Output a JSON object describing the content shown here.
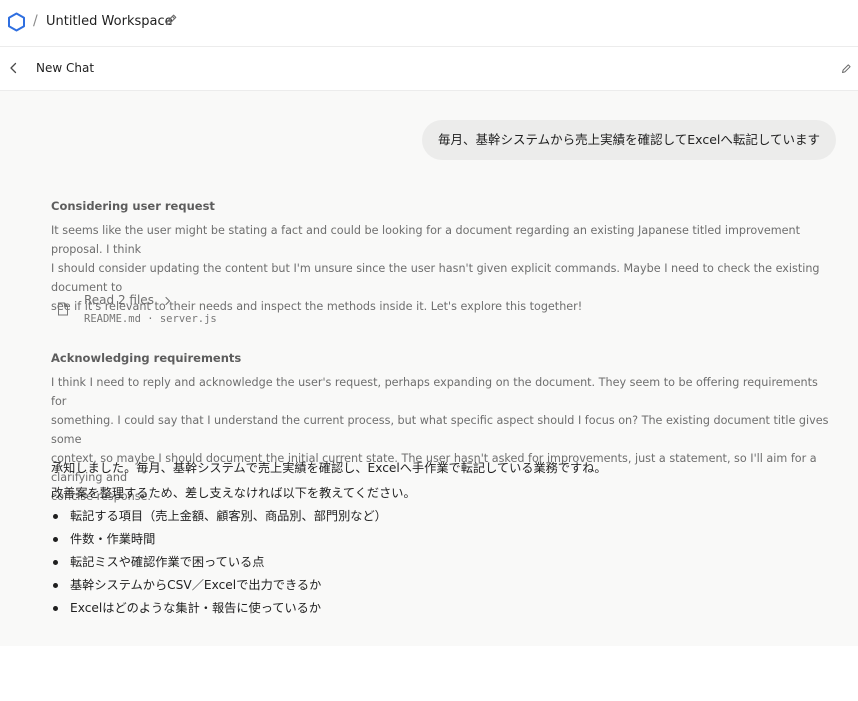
{
  "header": {
    "separator": "/",
    "workspace_title": "Untitled Workspace"
  },
  "chat": {
    "title": "New Chat"
  },
  "messages": {
    "user": "毎月、基幹システムから売上実績を確認してExcelへ転記しています",
    "thinking": [
      {
        "title": "Considering user request",
        "lines": [
          "It seems like the user might be stating a fact and could be looking for a document regarding an existing Japanese titled improvement proposal. I think",
          "I should consider updating the content but I'm unsure since the user hasn't given explicit commands. Maybe I need to check the existing document to",
          "see if it's relevant to their needs and inspect the methods inside it. Let's explore this together!"
        ]
      },
      {
        "title": "Acknowledging requirements",
        "lines": [
          "I think I need to reply and acknowledge the user's request, perhaps expanding on the document. They seem to be offering requirements for",
          "something. I could say that I understand the current process, but what specific aspect should I focus on? The existing document title gives some",
          "context, so maybe I should document the initial current state. The user hasn't asked for improvements, just a statement, so I'll aim for a clarifying and",
          "concise response."
        ]
      }
    ],
    "tool": {
      "label": "Read 2 files",
      "files": "README.md · server.js"
    },
    "assistant": {
      "line1": "承知しました。毎月、基幹システムで売上実績を確認し、Excelへ手作業で転記している業務ですね。",
      "line2": "改善案を整理するため、差し支えなければ以下を教えてください。",
      "bullets": [
        "転記する項目（売上金額、顧客別、商品別、部門別など）",
        "件数・作業時間",
        "転記ミスや確認作業で困っている点",
        "基幹システムからCSV／Excelで出力できるか",
        "Excelはどのような集計・報告に使っているか"
      ]
    }
  },
  "icons": {
    "logo": "hexagon-logo-icon",
    "edit": "pencil-icon",
    "back": "chevron-left-icon",
    "file": "file-icon",
    "expand": "chevron-right-icon"
  },
  "colors": {
    "accent": "#2f6fe0",
    "bubble": "#ececeb",
    "canvas": "#f9f9f8"
  }
}
